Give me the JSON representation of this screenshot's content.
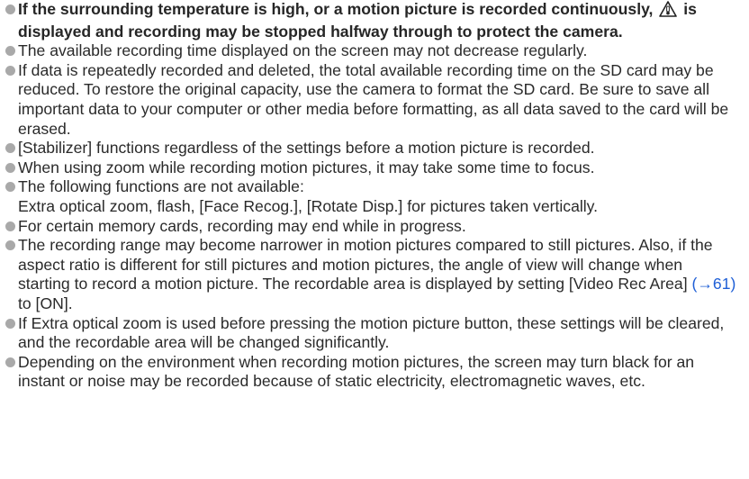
{
  "notes": [
    {
      "id": "heat",
      "bold": true,
      "text_before_icon": "If the surrounding temperature is high, or a motion picture is recorded continuously,",
      "icon": "temperature-warning-icon",
      "text_after_icon": "is displayed and recording may be stopped halfway through to protect the camera."
    },
    {
      "id": "time",
      "text": "The available recording time displayed on the screen may not decrease regularly."
    },
    {
      "id": "sd",
      "text": "If data is repeatedly recorded and deleted, the total available recording time on the SD card may be reduced. To restore the original capacity, use the camera to format the SD card. Be sure to save all important data to your computer or other media before formatting, as all data saved to the card will be erased."
    },
    {
      "id": "stabilizer",
      "text": "[Stabilizer] functions regardless of the settings before a motion picture is recorded."
    },
    {
      "id": "zoom",
      "text": "When using zoom while recording motion pictures, it may take some time to focus."
    },
    {
      "id": "unavailable",
      "text": "The following functions are not available:",
      "subtext": "Extra optical zoom, flash, [Face Recog.], [Rotate Disp.] for pictures taken vertically."
    },
    {
      "id": "memory",
      "text": "For certain memory cards, recording may end while in progress."
    },
    {
      "id": "range",
      "text_before_link": "The recording range may become narrower in motion pictures compared to still pictures. Also, if the aspect ratio is different for still pictures and motion pictures, the angle of view will change when starting to record a motion picture. The recordable area is displayed by setting [Video Rec Area]",
      "link": "(→61)",
      "text_after_link": "to [ON]."
    },
    {
      "id": "extra-zoom",
      "text": "If Extra optical zoom is used before pressing the motion picture button, these settings will be cleared, and the recordable area will be changed significantly."
    },
    {
      "id": "environment",
      "text": "Depending on the environment when recording motion pictures, the screen may turn black for an instant or noise may be recorded because of static electricity, electromagnetic waves, etc."
    }
  ],
  "colors": {
    "text": "#2a2a2a",
    "bullet": "#a9a9a9",
    "link": "#1f5fd6"
  }
}
